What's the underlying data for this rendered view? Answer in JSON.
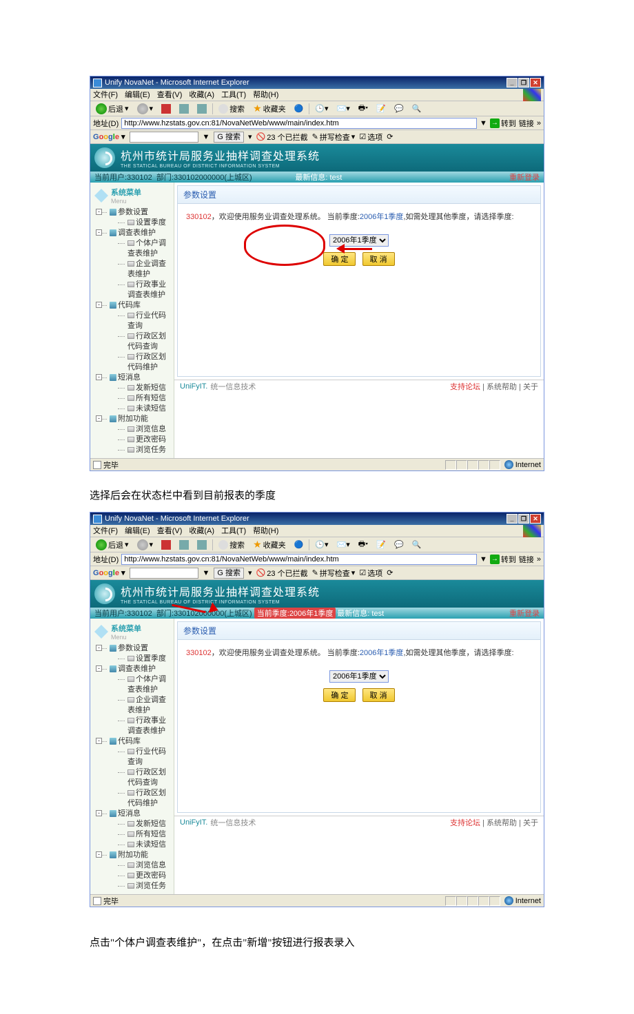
{
  "browser": {
    "title": "Unify NovaNet - Microsoft Internet Explorer",
    "menus": {
      "file": "文件(F)",
      "edit": "编辑(E)",
      "view": "查看(V)",
      "fav": "收藏(A)",
      "tools": "工具(T)",
      "help": "帮助(H)"
    },
    "toolbar": {
      "back": "后退",
      "search": "搜索",
      "favorites": "收藏夹"
    },
    "address": {
      "label": "地址(D)",
      "url": "http://www.hzstats.gov.cn:81/NovaNetWeb/www/main/index.htm",
      "go": "转到",
      "links": "链接"
    },
    "google": {
      "logo": "Google",
      "search_btn": "搜索",
      "blocked": "23 个已拦截",
      "spell": "拼写检查",
      "options": "选项"
    },
    "status": {
      "done": "完毕",
      "zone": "Internet"
    }
  },
  "app": {
    "banner_zh": "杭州市统计局服务业抽样调查处理系统",
    "banner_en": "THE STATICAL BUREAU OF DISTRICT INFORMATION SYSTEM",
    "infobar1": {
      "user": "当前用户:330102",
      "dept": "部门:330102000000(上城区)",
      "latest_label": "最新信息:",
      "latest": "test",
      "relogin": "重新登录"
    },
    "infobar2": {
      "user": "当前用户:330102",
      "dept": "部门:330102000000(上城区)",
      "quarter_label": "当前季度:",
      "quarter_value": "2006年1季度",
      "latest_label": "最新信息:",
      "latest": "test",
      "relogin": "重新登录"
    },
    "menu": {
      "title": "系统菜单",
      "title_en": "Menu"
    },
    "tree": {
      "param": {
        "label": "参数设置",
        "items": [
          "设置季度"
        ]
      },
      "survey": {
        "label": "调查表维护",
        "items": [
          "个体户调查表维护",
          "企业调查表维护",
          "行政事业调查表维护"
        ]
      },
      "code": {
        "label": "代码库",
        "items": [
          "行业代码查询",
          "行政区划代码查询",
          "行政区划代码维护"
        ]
      },
      "msg": {
        "label": "短消息",
        "items": [
          "发新短信",
          "所有短信",
          "未读短信"
        ]
      },
      "extra": {
        "label": "附加功能",
        "items": [
          "浏览信息",
          "更改密码",
          "浏览任务"
        ]
      }
    },
    "panel": {
      "title": "参数设置",
      "uid": "330102",
      "text1": "，欢迎使用服务业调查处理系统。 当前季度:",
      "quarter_link": "2006年1季度",
      "text2": ",如需处理其他季度，请选择季度:",
      "select_value": "2006年1季度",
      "ok": "确 定",
      "cancel": "取 消"
    },
    "footer": {
      "brand": "UniFyIT.",
      "slogan": "统一信息技术",
      "forum": "支持论坛",
      "help": "系统帮助",
      "about": "关于"
    }
  },
  "captions": {
    "c1": "选择后会在状态栏中看到目前报表的季度",
    "c2": "点击\"个体户调查表维护\"，在点击\"新增\"按钮进行报表录入"
  }
}
